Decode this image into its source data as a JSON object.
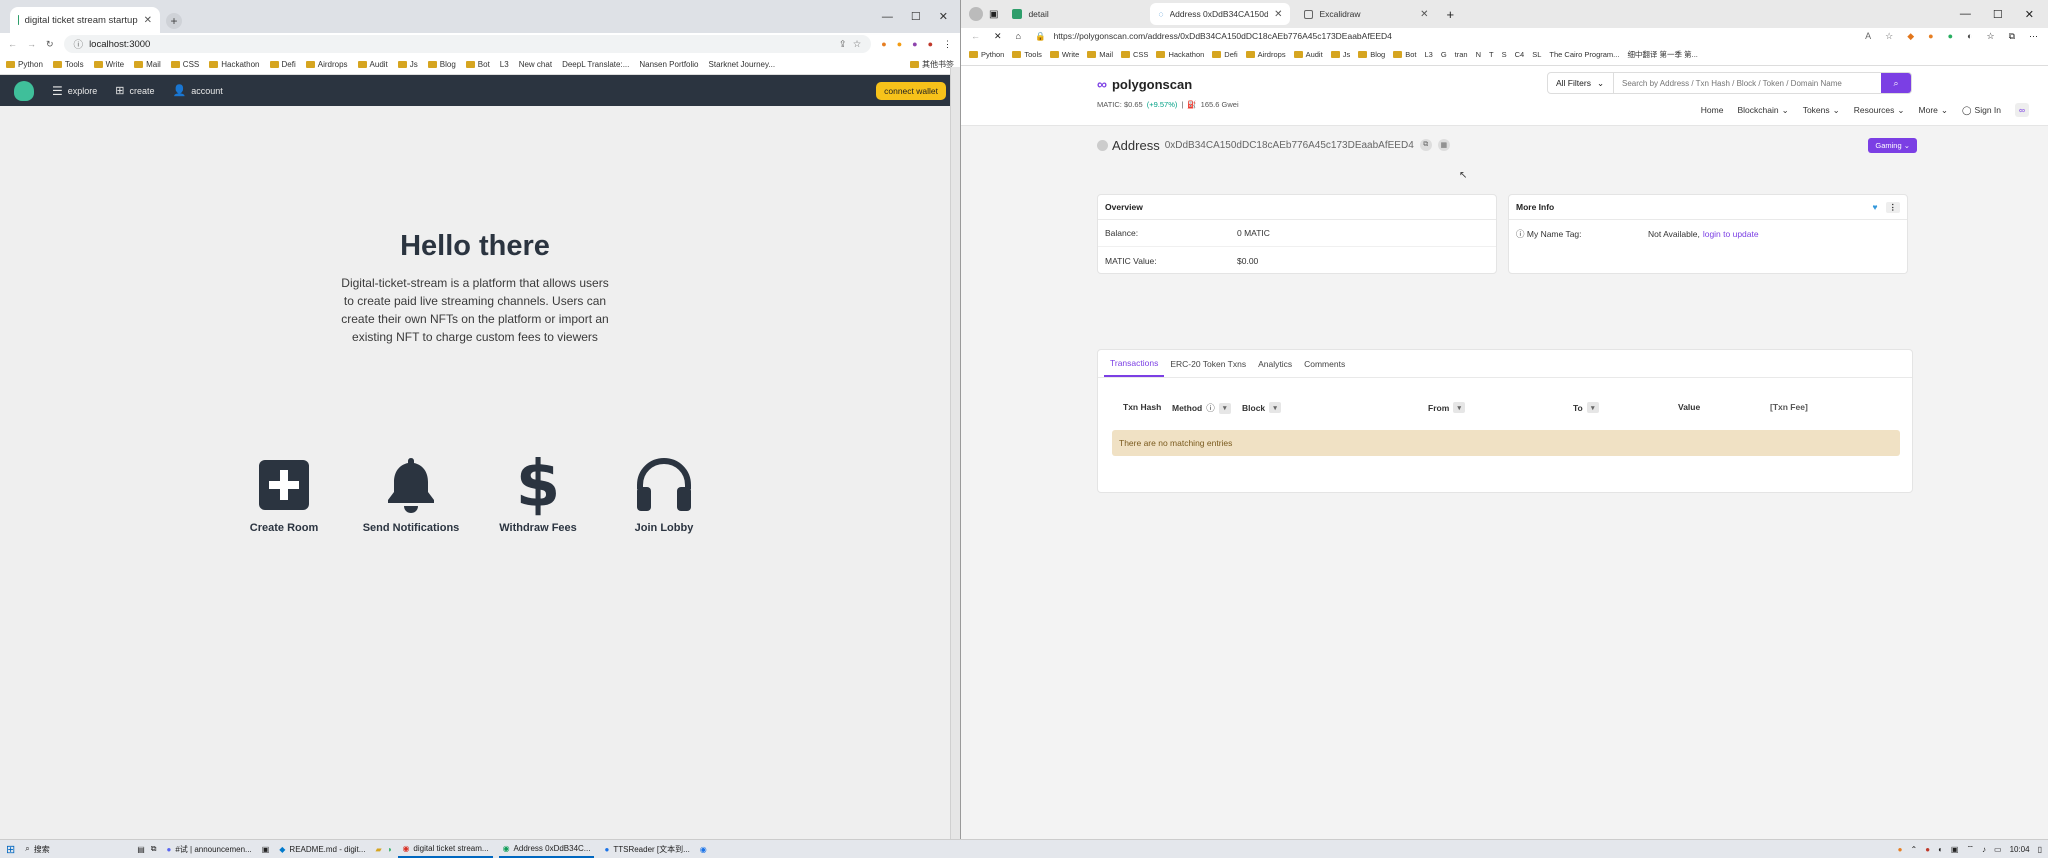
{
  "left_window": {
    "tab_title": "digital ticket stream startup",
    "address": "localhost:3000",
    "bookmarks": [
      {
        "label": "Python",
        "folder": true
      },
      {
        "label": "Tools",
        "folder": true
      },
      {
        "label": "Write",
        "folder": true
      },
      {
        "label": "Mail",
        "folder": true
      },
      {
        "label": "CSS",
        "folder": true
      },
      {
        "label": "Hackathon",
        "folder": true
      },
      {
        "label": "Defi",
        "folder": true
      },
      {
        "label": "Airdrops",
        "folder": true
      },
      {
        "label": "Audit",
        "folder": true
      },
      {
        "label": "Js",
        "folder": true
      },
      {
        "label": "Blog",
        "folder": true
      },
      {
        "label": "Bot",
        "folder": true
      },
      {
        "label": "L3",
        "folder": false
      },
      {
        "label": "New chat",
        "folder": false
      },
      {
        "label": "DeepL Translate:...",
        "folder": false
      },
      {
        "label": "Nansen Portfolio",
        "folder": false
      },
      {
        "label": "Starknet Journey...",
        "folder": false
      }
    ],
    "bookmarks_other": "其他书签",
    "app": {
      "nav": {
        "explore": "explore",
        "create": "create",
        "account": "account"
      },
      "connect_wallet": "connect wallet",
      "hero_title": "Hello there",
      "hero_text": "Digital-ticket-stream is a platform that allows users to create paid live streaming channels. Users can create their own NFTs on the platform or import an existing NFT to charge custom fees to viewers",
      "features": {
        "create_room": "Create Room",
        "send_notifications": "Send Notifications",
        "withdraw_fees": "Withdraw Fees",
        "join_lobby": "Join Lobby"
      }
    }
  },
  "right_window": {
    "tabs": [
      "detail",
      "Address 0xDdB34CA150dDC18c...",
      "Excalidraw"
    ],
    "url": "https://polygonscan.com/address/0xDdB34CA150dDC18cAEb776A45c173DEaabAfEED4",
    "bookmarks": [
      {
        "label": "Python",
        "folder": true
      },
      {
        "label": "Tools",
        "folder": true
      },
      {
        "label": "Write",
        "folder": true
      },
      {
        "label": "Mail",
        "folder": true
      },
      {
        "label": "CSS",
        "folder": true
      },
      {
        "label": "Hackathon",
        "folder": true
      },
      {
        "label": "Defi",
        "folder": true
      },
      {
        "label": "Airdrops",
        "folder": true
      },
      {
        "label": "Audit",
        "folder": true
      },
      {
        "label": "Js",
        "folder": true
      },
      {
        "label": "Blog",
        "folder": true
      },
      {
        "label": "Bot",
        "folder": true
      },
      {
        "label": "L3",
        "folder": false
      },
      {
        "label": "G",
        "folder": false
      },
      {
        "label": "tran",
        "folder": false
      },
      {
        "label": "N",
        "folder": false
      },
      {
        "label": "T",
        "folder": false
      },
      {
        "label": "S",
        "folder": false
      },
      {
        "label": "C4",
        "folder": false
      },
      {
        "label": "SL",
        "folder": false
      },
      {
        "label": "The Cairo Program...",
        "folder": false
      },
      {
        "label": "细中翻译 第一季 第...",
        "folder": false
      }
    ],
    "site": {
      "logo": "polygonscan",
      "matic_price": "MATIC: $0.65",
      "matic_change": "(+9.57%)",
      "gas": "165.6 Gwei",
      "filter_label": "All Filters",
      "search_placeholder": "Search by Address / Txn Hash / Block / Token / Domain Name",
      "menu": {
        "home": "Home",
        "blockchain": "Blockchain",
        "tokens": "Tokens",
        "resources": "Resources",
        "more": "More",
        "sign_in": "Sign In"
      },
      "address_label": "Address",
      "address": "0xDdB34CA150dDC18cAEb776A45c173DEaabAfEED4",
      "gaming": "Gaming",
      "overview": {
        "title": "Overview",
        "balance_label": "Balance:",
        "balance": "0 MATIC",
        "value_label": "MATIC Value:",
        "value": "$0.00"
      },
      "more_info": {
        "title": "More Info",
        "name_tag_label": "My Name Tag:",
        "name_tag_value": "Not Available,",
        "name_tag_link": "login to update"
      },
      "tabs": {
        "transactions": "Transactions",
        "erc20": "ERC-20 Token Txns",
        "analytics": "Analytics",
        "comments": "Comments"
      },
      "columns": {
        "txn_hash": "Txn Hash",
        "method": "Method",
        "block": "Block",
        "from": "From",
        "to": "To",
        "value": "Value",
        "txn_fee": "[Txn Fee]"
      },
      "empty_message": "There are no matching entries"
    }
  },
  "taskbar": {
    "search": "搜索",
    "items": [
      "#试 | announcemen...",
      "README.md - digit...",
      "digital ticket stream...",
      "Address 0xDdB34C...",
      "TTSReader [文本到..."
    ],
    "clock": "10:04"
  }
}
